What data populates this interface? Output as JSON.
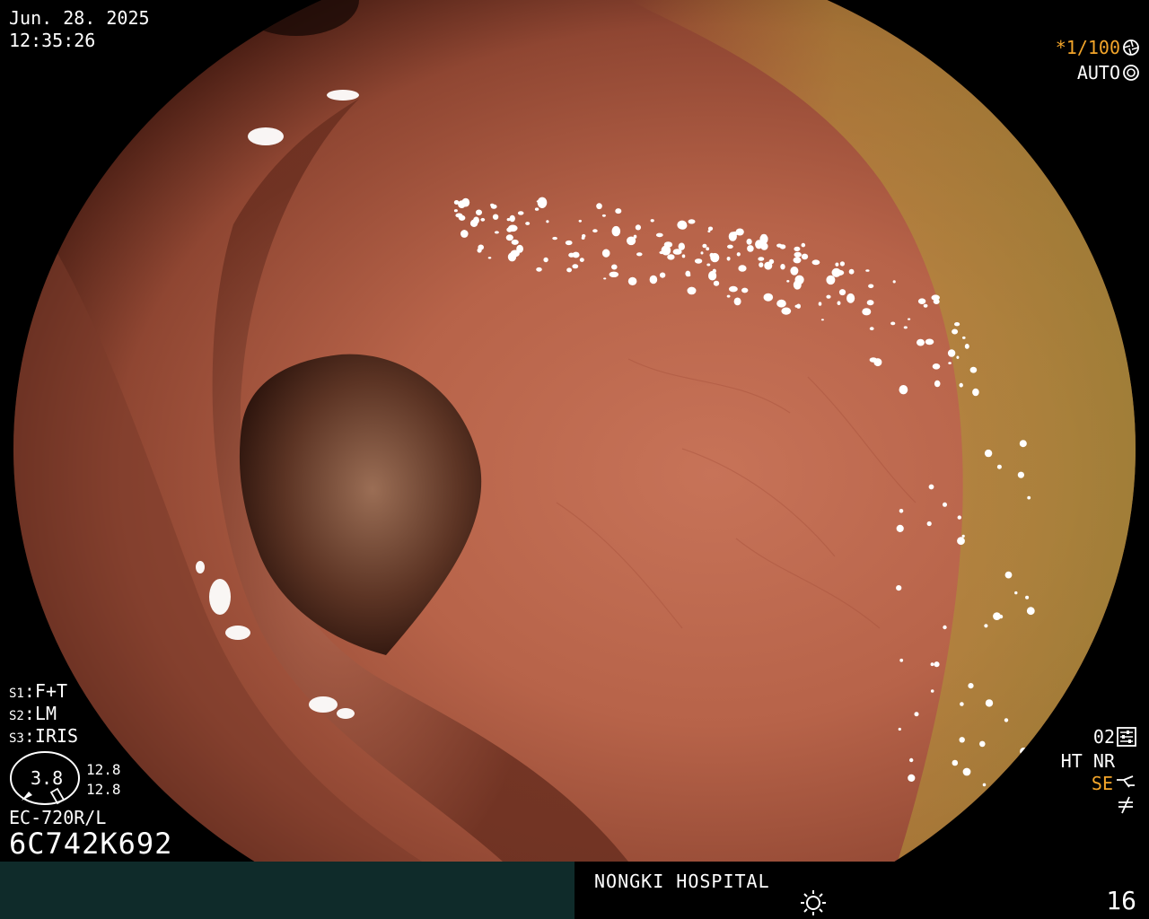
{
  "overlay": {
    "date": "Jun. 28. 2025",
    "time": "12:35:26",
    "shutter": "*1/100",
    "iris_mode": "AUTO",
    "settings": [
      {
        "key": "S1",
        "value": "F+T"
      },
      {
        "key": "S2",
        "value": "LM"
      },
      {
        "key": "S3",
        "value": "IRIS"
      }
    ],
    "gauge_value": "3.8",
    "gauge_top": "12.8",
    "gauge_bottom": "12.8",
    "scope_model": "EC-720R/L",
    "scope_serial": "6C742K692",
    "mode_code": "02",
    "ht": "HT",
    "nr": "NR",
    "se": "SE"
  },
  "footer": {
    "hospital": "NONGKI HOSPITAL",
    "frame_number": "16"
  },
  "icons": {
    "shutter": "aperture-icon",
    "iris": "iris-icon",
    "mode": "settings-sliders-icon",
    "se": "scope-tip-icon",
    "freeze": "freeze-icon",
    "light": "sun-icon",
    "gauge": "insertion-gauge-icon"
  },
  "colors": {
    "highlight": "#f3a52a",
    "footer_bar": "#0f2b2a",
    "mucosa": "#b4634a"
  }
}
